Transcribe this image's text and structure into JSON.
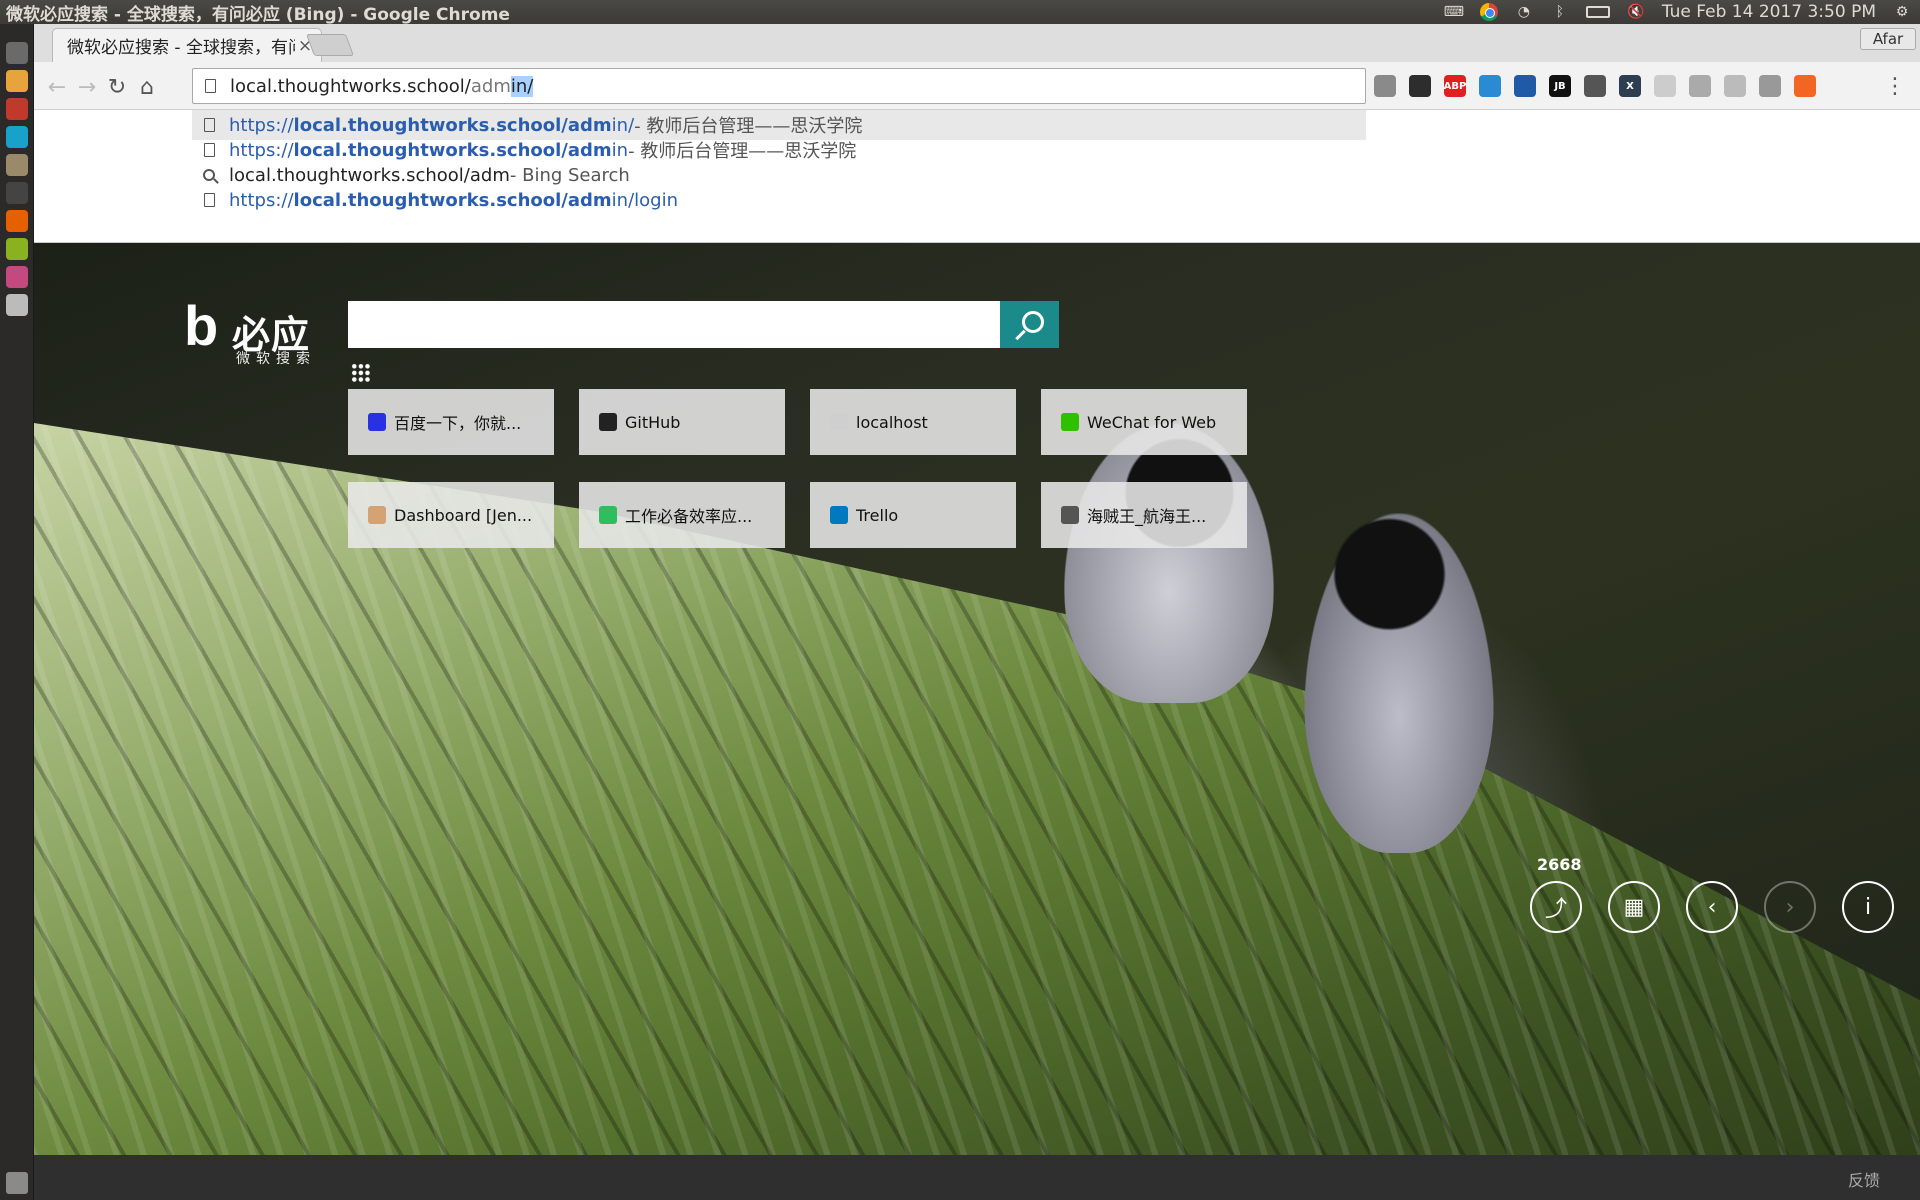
{
  "os": {
    "window_title": "微软必应搜索 - 全球搜索，有问必应 (Bing) - Google Chrome",
    "datetime": "Tue Feb 14 2017  3:50 PM",
    "indicators": [
      "keyboard-icon",
      "chrome-icon",
      "wifi-icon",
      "bluetooth-icon",
      "battery-icon",
      "volume-muted-icon",
      "gear-icon"
    ]
  },
  "launcher": {
    "apps": [
      {
        "name": "dash-icon",
        "color": "#6a6a6a"
      },
      {
        "name": "chrome-app-icon",
        "color": "#e8a33c"
      },
      {
        "name": "red-app-icon",
        "color": "#c0392b"
      },
      {
        "name": "webstorm-app-icon",
        "color": "#18a2c9"
      },
      {
        "name": "files-app-icon",
        "color": "#9a8a6a"
      },
      {
        "name": "terminal-app-icon",
        "color": "#444444"
      },
      {
        "name": "firefox-app-icon",
        "color": "#e66000"
      },
      {
        "name": "mailspring-app-icon",
        "color": "#89b120"
      },
      {
        "name": "store-app-icon",
        "color": "#c3497f"
      },
      {
        "name": "disk-app-icon",
        "color": "#bbbbbb"
      }
    ]
  },
  "browser": {
    "tab_title": "微软必应搜索 - 全球搜索，有问必应 (Bing)",
    "tab_close": "×",
    "profile": "Afar",
    "url_prefix": "local.thoughtworks.school/",
    "url_dim": "adm",
    "url_selected": "in/",
    "extensions": [
      {
        "name": "ext-clock-icon",
        "color": "#8a8a8a",
        "label": ""
      },
      {
        "name": "ext-evernote-icon",
        "color": "#2d2d2d",
        "label": ""
      },
      {
        "name": "ext-adblock-icon",
        "color": "#e02020",
        "label": "ABP"
      },
      {
        "name": "ext-globe-icon",
        "color": "#2a8ad4",
        "label": ""
      },
      {
        "name": "ext-jira-icon",
        "color": "#1f5aa6",
        "label": ""
      },
      {
        "name": "ext-jb-icon",
        "color": "#111111",
        "label": "JB"
      },
      {
        "name": "ext-contrast-icon",
        "color": "#555555",
        "label": ""
      },
      {
        "name": "ext-x-icon",
        "color": "#2c3e50",
        "label": "X"
      },
      {
        "name": "ext-network-icon",
        "color": "#cccccc",
        "label": ""
      },
      {
        "name": "ext-grid-icon",
        "color": "#aaaaaa",
        "label": ""
      },
      {
        "name": "ext-react-icon",
        "color": "#bbbbbb",
        "label": ""
      },
      {
        "name": "ext-panel-icon",
        "color": "#999999",
        "label": ""
      },
      {
        "name": "ext-orange-icon",
        "color": "#f26522",
        "label": ""
      }
    ]
  },
  "suggestions": [
    {
      "icon": "page-icon",
      "scheme": "https://",
      "bold": "local.thoughtworks.school/adm",
      "rest": "in/",
      "desc": " - 教师后台管理——思沃学院",
      "selected": true
    },
    {
      "icon": "page-icon",
      "scheme": "https://",
      "bold": "local.thoughtworks.school/adm",
      "rest": "in",
      "desc": " - 教师后台管理——思沃学院",
      "selected": false
    },
    {
      "icon": "search-icon",
      "text": "local.thoughtworks.school/adm",
      "desc": " - Bing Search",
      "selected": false
    },
    {
      "icon": "page-icon",
      "scheme": "https://",
      "bold": "local.thoughtworks.school/adm",
      "rest": "in/login",
      "desc": "",
      "selected": false
    }
  ],
  "bing": {
    "logo_mark": "b",
    "logo_name": "必应",
    "logo_sub": "微软搜索",
    "search_value": "",
    "tiles": [
      {
        "label": "百度一下，你就...",
        "icon": "baidu-icon",
        "color": "#2932e1"
      },
      {
        "label": "GitHub",
        "icon": "github-icon",
        "color": "#222222"
      },
      {
        "label": "localhost",
        "icon": "page-icon",
        "color": "#cfcfcf"
      },
      {
        "label": "WeChat for Web",
        "icon": "wechat-icon",
        "color": "#2dc100"
      },
      {
        "label": "Dashboard [Jen...",
        "icon": "jenkins-icon",
        "color": "#d4a373"
      },
      {
        "label": "工作必备效率应...",
        "icon": "evernote-icon",
        "color": "#2dbe60"
      },
      {
        "label": "Trello",
        "icon": "trello-icon",
        "color": "#0079bf"
      },
      {
        "label": "海贼王_航海王...",
        "icon": "pirate-icon",
        "color": "#555555"
      }
    ],
    "counter": "2668",
    "feedback": "反馈"
  }
}
